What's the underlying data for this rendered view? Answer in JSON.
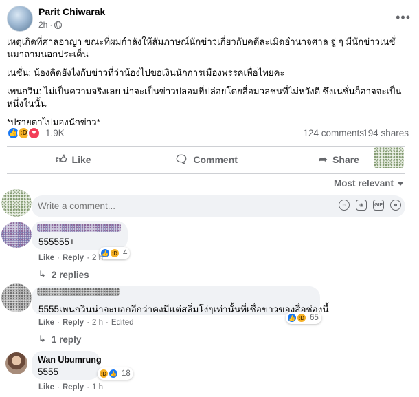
{
  "post": {
    "author": "Parit Chiwarak",
    "time": "2h",
    "more_icon": "more-horizontal-icon",
    "privacy_icon": "globe-icon",
    "paragraphs": [
      "เหตุเกิดที่ศาลอาญา ขณะที่ผมกำลังให้สัมภาษณ์นักข่าวเกี่ยวกับคดีละเมิดอำนาจศาล จู่ ๆ มีนักข่าวเนชั่นมาถามนอกประเด็น",
      "เนชั่น: น้องคิดยังไงกับข่าวที่ว่าน้องไปขอเงินนักการเมืองพรรคเพื่อไทยคะ",
      "เพนกวิน: ไม่เป็นความจริงเลย น่าจะเป็นข่าวปลอมที่ปล่อยโดยสื่อมวลชนที่ไม่หวังดี ซึ่งเนชั่นก็อาจจะเป็นหนึ่งในนั้น",
      "*ปรายตาไปมองนักข่าว*"
    ]
  },
  "stats": {
    "reaction_icons": [
      "like-icon",
      "haha-icon",
      "love-icon"
    ],
    "reactions": "1.9K",
    "comments": "124 comments",
    "shares": "194 shares"
  },
  "actions": {
    "like": "Like",
    "comment": "Comment",
    "share": "Share"
  },
  "sort": {
    "label": "Most relevant"
  },
  "composer": {
    "placeholder": "Write a comment...",
    "tools": [
      "emoji-icon",
      "camera-icon",
      "gif-icon",
      "sticker-icon"
    ]
  },
  "comments": [
    {
      "name": "",
      "text": "555555+",
      "reaction_count": "4",
      "like": "Like",
      "reply": "Reply",
      "time": "2 h",
      "replies_label": "2 replies"
    },
    {
      "name": "",
      "text": "5555เพนกวินน่าจะบอกอีกว่าคงมีแต่สลิ่มโง่ๆเท่านั้นที่เชื่อข่าวของสื่อช่องนี้",
      "reaction_count": "65",
      "like": "Like",
      "reply": "Reply",
      "time": "2 h",
      "edited": "Edited",
      "replies_label": "1 reply"
    },
    {
      "name": "Wan Ubumrung",
      "text": "5555",
      "reaction_count": "18",
      "like": "Like",
      "reply": "Reply",
      "time": "1 h"
    }
  ],
  "colors": {
    "like_blue": "#1877f2",
    "haha_yellow": "#f7b125",
    "love_red": "#f33e58",
    "secondary_text": "#65676b",
    "bubble_bg": "#f0f2f5"
  }
}
